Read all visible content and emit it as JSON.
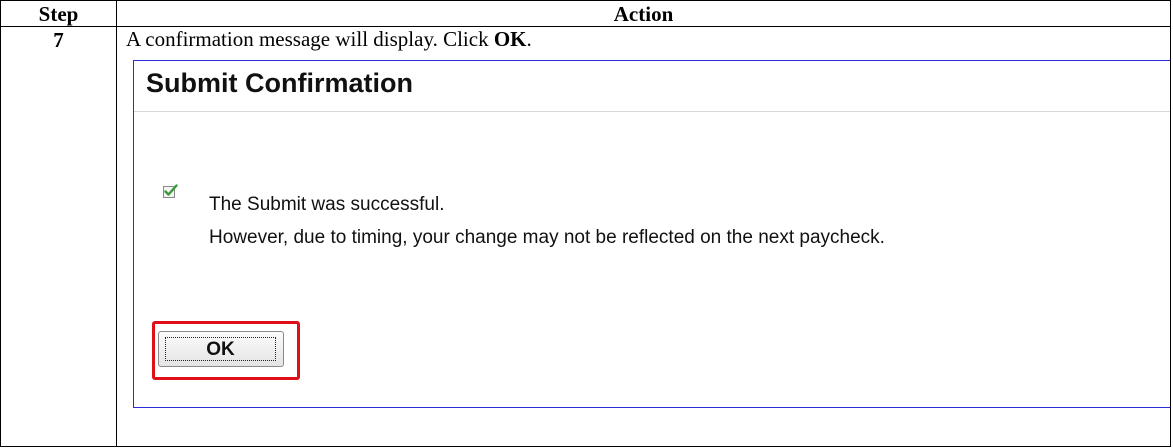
{
  "table": {
    "header": {
      "step": "Step",
      "action": "Action"
    },
    "row": {
      "step_number": "7",
      "instruction_text": "A confirmation message will display.  Click ",
      "instruction_bold": "OK",
      "instruction_end": "."
    }
  },
  "screenshot": {
    "title": "Submit Confirmation",
    "message_line1": "The Submit was successful.",
    "message_line2": "However, due to timing, your change may not be reflected on the next paycheck.",
    "check_icon": "checkbox-checked-icon",
    "ok_label": "OK",
    "colors": {
      "frame_border": "#2b2bd8",
      "highlight": "#e0101a",
      "check": "#3a9a3a"
    }
  }
}
